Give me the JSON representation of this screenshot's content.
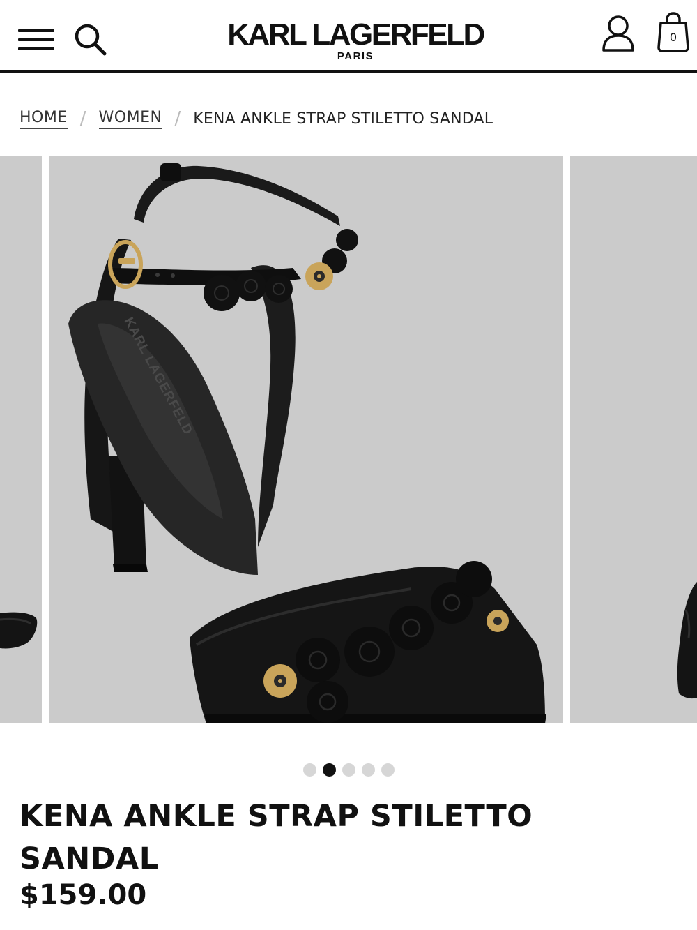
{
  "header": {
    "brand": "KARL LAGERFELD",
    "brand_sub": "PARIS",
    "bag_count": "0",
    "icons": {
      "menu": "hamburger-menu-icon",
      "search": "search-icon",
      "account": "user-icon",
      "bag": "shopping-bag-icon"
    }
  },
  "breadcrumb": {
    "home": "HOME",
    "separator_1": "/",
    "women": "WOMEN",
    "separator_2": "/",
    "current": "KENA ANKLE STRAP STILETTO SANDAL"
  },
  "gallery": {
    "slide_count": 5,
    "active_index": 1,
    "insole_brand_print": "KARL LAGERFELD",
    "colors": {
      "background": "#cbcbcb",
      "product": "#141414",
      "accent_gold": "#c9a45a"
    }
  },
  "product": {
    "title": "KENA ANKLE STRAP STILETTO SANDAL",
    "price": "$159.00"
  }
}
